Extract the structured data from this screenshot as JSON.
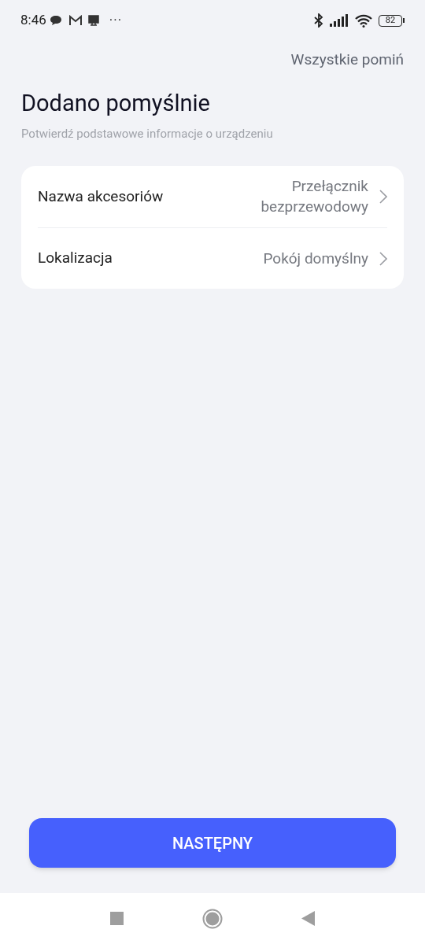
{
  "status_bar": {
    "time": "8:46",
    "more": "···",
    "battery": "82"
  },
  "skip_all": "Wszystkie pomiń",
  "title": "Dodano pomyślnie",
  "subtitle": "Potwierdź podstawowe informacje o urządzeniu",
  "settings": [
    {
      "label": "Nazwa akcesoriów",
      "value": "Przełącznik bezprzewodowy"
    },
    {
      "label": "Lokalizacja",
      "value": "Pokój domyślny"
    }
  ],
  "next_button": "NASTĘPNY"
}
